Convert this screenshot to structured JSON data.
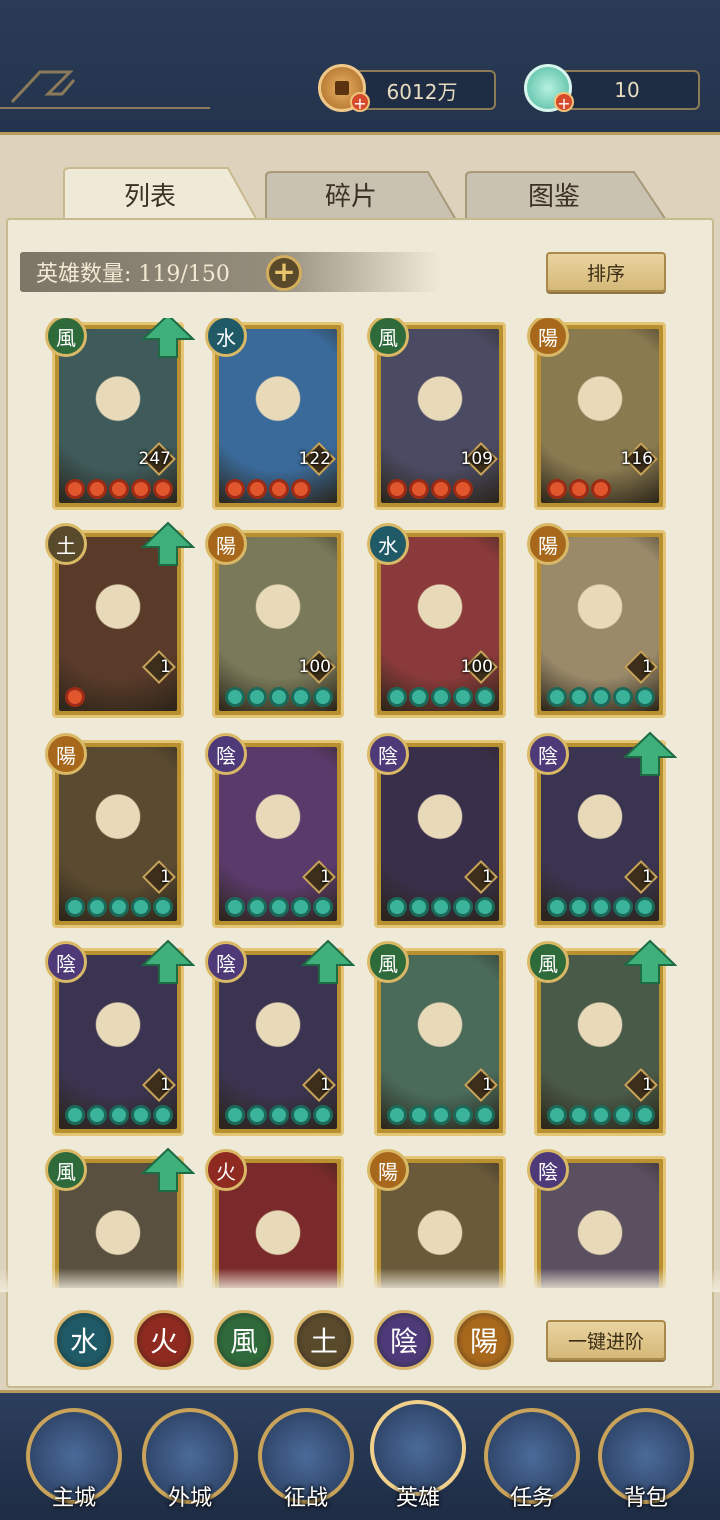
{
  "header": {
    "coins": {
      "icon": "copper-coin-icon",
      "value": "6012万"
    },
    "jade": {
      "icon": "jade-shell-icon",
      "value": "10"
    }
  },
  "tabs": [
    {
      "label": "列表",
      "active": true
    },
    {
      "label": "碎片",
      "active": false
    },
    {
      "label": "图鉴",
      "active": false
    }
  ],
  "hero_count": {
    "label": "英雄数量:",
    "value": "119/150"
  },
  "sort_label": "排序",
  "heroes": [
    {
      "element": "風",
      "level": "247",
      "stars": 5,
      "star_color": "red",
      "upgrade": true
    },
    {
      "element": "水",
      "level": "122",
      "stars": 4,
      "star_color": "red",
      "upgrade": false
    },
    {
      "element": "風",
      "level": "109",
      "stars": 4,
      "star_color": "red",
      "upgrade": false
    },
    {
      "element": "陽",
      "level": "116",
      "stars": 3,
      "star_color": "red",
      "upgrade": false
    },
    {
      "element": "土",
      "level": "1",
      "stars": 1,
      "star_color": "red",
      "upgrade": true
    },
    {
      "element": "陽",
      "level": "100",
      "stars": 5,
      "star_color": "teal",
      "upgrade": false
    },
    {
      "element": "水",
      "level": "100",
      "stars": 5,
      "star_color": "teal",
      "upgrade": false
    },
    {
      "element": "陽",
      "level": "1",
      "stars": 5,
      "star_color": "teal",
      "upgrade": false
    },
    {
      "element": "陽",
      "level": "1",
      "stars": 5,
      "star_color": "teal",
      "upgrade": false
    },
    {
      "element": "陰",
      "level": "1",
      "stars": 5,
      "star_color": "teal",
      "upgrade": false
    },
    {
      "element": "陰",
      "level": "1",
      "stars": 5,
      "star_color": "teal",
      "upgrade": false
    },
    {
      "element": "陰",
      "level": "1",
      "stars": 5,
      "star_color": "teal",
      "upgrade": true
    },
    {
      "element": "陰",
      "level": "1",
      "stars": 5,
      "star_color": "teal",
      "upgrade": true
    },
    {
      "element": "陰",
      "level": "1",
      "stars": 5,
      "star_color": "teal",
      "upgrade": true
    },
    {
      "element": "風",
      "level": "1",
      "stars": 5,
      "star_color": "teal",
      "upgrade": false
    },
    {
      "element": "風",
      "level": "1",
      "stars": 5,
      "star_color": "teal",
      "upgrade": true
    },
    {
      "element": "風",
      "level": "",
      "stars": 0,
      "star_color": "teal",
      "upgrade": true
    },
    {
      "element": "火",
      "level": "",
      "stars": 0,
      "star_color": "teal",
      "upgrade": false
    },
    {
      "element": "陽",
      "level": "",
      "stars": 0,
      "star_color": "teal",
      "upgrade": false
    },
    {
      "element": "陰",
      "level": "",
      "stars": 0,
      "star_color": "teal",
      "upgrade": false
    }
  ],
  "element_filters": [
    {
      "glyph": "水",
      "name": "water-filter-icon",
      "color": "#1f5a66"
    },
    {
      "glyph": "火",
      "name": "fire-filter-icon",
      "color": "#8e2a1f"
    },
    {
      "glyph": "風",
      "name": "wind-filter-icon",
      "color": "#2f6a3b"
    },
    {
      "glyph": "土",
      "name": "earth-filter-icon",
      "color": "#5a4a2c"
    },
    {
      "glyph": "陰",
      "name": "yin-filter-icon",
      "color": "#4e3a78"
    },
    {
      "glyph": "陽",
      "name": "yang-filter-icon",
      "color": "#a8681c"
    }
  ],
  "one_key_advance_label": "一键进阶",
  "element_colors": {
    "風": "#2f6a3b",
    "水": "#1f5a66",
    "陽": "#a8681c",
    "土": "#5a4a2c",
    "陰": "#4e3a78",
    "火": "#8e2a1f"
  },
  "portrait_colors": [
    "#3e5a5a",
    "#3a6a9a",
    "#4a4a62",
    "#8a7a50",
    "#5a3b2a",
    "#7a7a5a",
    "#8a3a3a",
    "#9a8a6a",
    "#5a4a30",
    "#5a3a6a",
    "#3a2f4a",
    "#3a3450",
    "#3a3450",
    "#3a3450",
    "#4a6a5a",
    "#4a5a48",
    "#5a5040",
    "#7a2a2a",
    "#6a5a3a",
    "#5a5060"
  ],
  "bottom_nav": [
    {
      "label": "主城",
      "icon": "main-city-icon"
    },
    {
      "label": "外城",
      "icon": "outer-city-icon"
    },
    {
      "label": "征战",
      "icon": "campaign-icon"
    },
    {
      "label": "英雄",
      "icon": "hero-icon"
    },
    {
      "label": "任务",
      "icon": "quest-icon"
    },
    {
      "label": "背包",
      "icon": "bag-icon"
    }
  ]
}
